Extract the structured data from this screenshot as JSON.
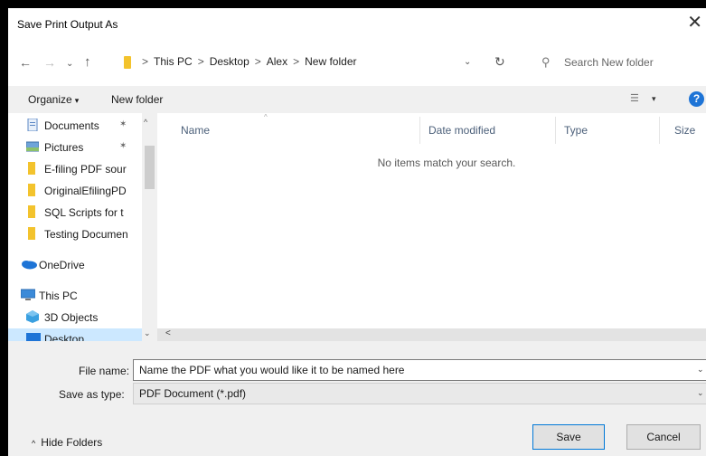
{
  "window": {
    "title": "Save Print Output As",
    "close_glyph": "✕"
  },
  "nav": {
    "back": "←",
    "forward": "→",
    "recent": "⌄",
    "up": "↑"
  },
  "address": {
    "crumbs": [
      "This PC",
      "Desktop",
      "Alex",
      "New folder"
    ],
    "separator": ">",
    "dropdown_glyph": "⌄",
    "refresh_glyph": "↻"
  },
  "search": {
    "placeholder": "Search New folder",
    "icon": "search-icon"
  },
  "toolbar": {
    "organize": "Organize",
    "caret": "▾",
    "new_folder": "New folder",
    "view_glyph": "☰",
    "view_dd": "▾",
    "help": "?"
  },
  "sidebar": {
    "items": [
      {
        "label": "Documents",
        "icon": "documents-icon",
        "pinned": true
      },
      {
        "label": "Pictures",
        "icon": "pictures-icon",
        "pinned": true
      },
      {
        "label": "E-filing PDF sour",
        "icon": "folder-icon"
      },
      {
        "label": "OriginalEfilingPD",
        "icon": "folder-icon"
      },
      {
        "label": "SQL Scripts for t",
        "icon": "folder-icon"
      },
      {
        "label": "Testing Documen",
        "icon": "folder-icon"
      },
      {
        "label": "OneDrive",
        "icon": "onedrive-icon"
      },
      {
        "label": "This PC",
        "icon": "this-pc-icon"
      },
      {
        "label": "3D Objects",
        "icon": "3d-objects-icon"
      },
      {
        "label": "Desktop",
        "icon": "desktop-icon",
        "selected": true
      }
    ],
    "pin_glyph": "📌"
  },
  "columns": [
    "Name",
    "Date modified",
    "Type",
    "Size"
  ],
  "empty_message": "No items match your search.",
  "form": {
    "file_name_label": "File name:",
    "file_name_value": "Name the PDF what you would like it to be named here",
    "save_type_label": "Save as type:",
    "save_type_value": "PDF Document (*.pdf)"
  },
  "footer": {
    "hide_folders": "Hide Folders",
    "save": "Save",
    "cancel": "Cancel"
  },
  "colors": {
    "accent": "#0078d7",
    "folder": "#f3c32d",
    "selection": "#cce8ff",
    "help": "#1e74d6"
  }
}
